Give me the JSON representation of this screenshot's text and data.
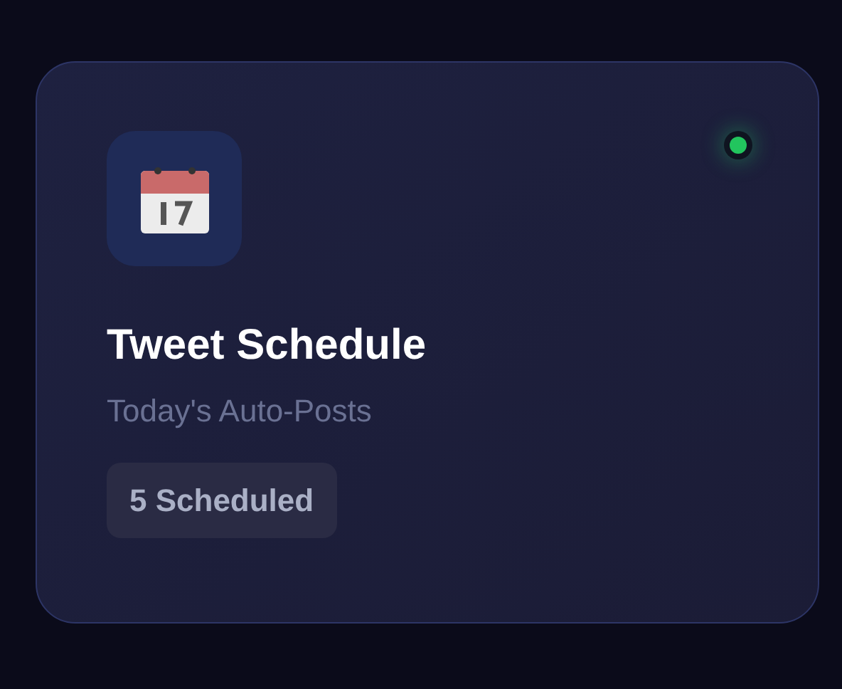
{
  "card": {
    "title": "Tweet Schedule",
    "subtitle": "Today's Auto-Posts",
    "badge": "5 Scheduled",
    "status_dot": {
      "color": "#22c55e"
    }
  }
}
